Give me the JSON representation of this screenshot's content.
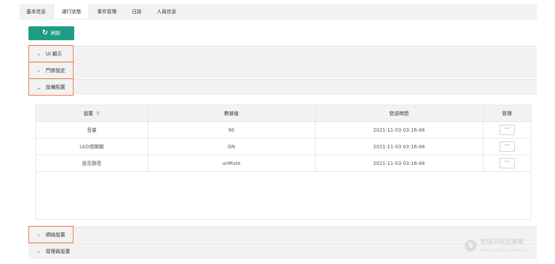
{
  "tabs": [
    {
      "label": "基本信息"
    },
    {
      "label": "運行狀態"
    },
    {
      "label": "事件管理"
    },
    {
      "label": "日誌"
    },
    {
      "label": "人員信息"
    }
  ],
  "refresh_label": "刷新",
  "panels": {
    "ui_display": {
      "label": "UI 顯示"
    },
    "door_settings": {
      "label": "門禁設定"
    },
    "device_config": {
      "label": "設備配置"
    },
    "network_settings": {
      "label": "網絡設置"
    },
    "admin_settings": {
      "label": "管理員設置"
    }
  },
  "table": {
    "headers": {
      "setting": "設置",
      "value": "數據值",
      "sent_time": "發送時間",
      "manage": "管理"
    },
    "rows": [
      {
        "setting": "音量",
        "value": "90",
        "sent_time": "2021-11-03 03:16:48",
        "manage": "···"
      },
      {
        "setting": "LED燈開關",
        "value": "ON",
        "sent_time": "2021-11-03 03:16:48",
        "manage": "···"
      },
      {
        "setting": "是否靜音",
        "value": "unMute",
        "sent_time": "2021-11-03 03:16:48",
        "manage": "···"
      }
    ]
  },
  "watermark": {
    "line1": "安瑞夫科技事業",
    "line2": "www.stuffcaiwan.c..."
  },
  "colors": {
    "accent": "#1e9c86",
    "highlight": "#f07a3b"
  }
}
